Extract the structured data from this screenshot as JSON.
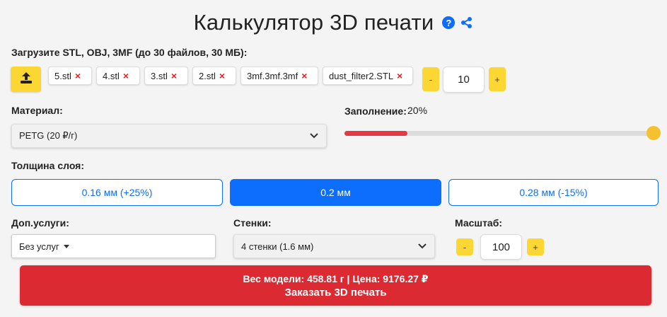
{
  "header": {
    "title": "Калькулятор 3D печати",
    "help_icon": "?",
    "share_icon": "share-icon"
  },
  "upload": {
    "label": "Загрузите STL, OBJ, 3MF (до 30 файлов, 30 МБ):",
    "button_icon": "upload-icon",
    "files": [
      "5.stl",
      "4.stl",
      "3.stl",
      "2.stl",
      "3mf.3mf.3mf",
      "dust_filter2.STL"
    ],
    "remove_glyph": "×"
  },
  "quantity": {
    "minus": "-",
    "value": "10",
    "plus": "+"
  },
  "material": {
    "label": "Материал:",
    "selected": "PETG (20 ₽/г)"
  },
  "infill": {
    "label": "Заполнение:",
    "value_text": "20%",
    "level": 0.2
  },
  "layer": {
    "label": "Толщина слоя:",
    "options": [
      "0.16 мм (+25%)",
      "0.2 мм",
      "0.28 мм (-15%)"
    ],
    "selected": "0.2 мм"
  },
  "extras": {
    "label": "Доп.услуги:",
    "selected": "Без услуг"
  },
  "walls": {
    "label": "Стенки:",
    "selected": "4 стенки (1.6 мм)"
  },
  "scale": {
    "label": "Масштаб:",
    "minus": "-",
    "value": "100",
    "plus": "+"
  },
  "order": {
    "summary": "Вес модели: 458.81 г | Цена: 9176.27 ₽",
    "action": "Заказать 3D печать"
  },
  "colors": {
    "accent_yellow": "#fcd734",
    "primary_blue": "#0d6efd",
    "danger_red": "#dc2a33",
    "slider_thumb": "#f6c12e"
  }
}
